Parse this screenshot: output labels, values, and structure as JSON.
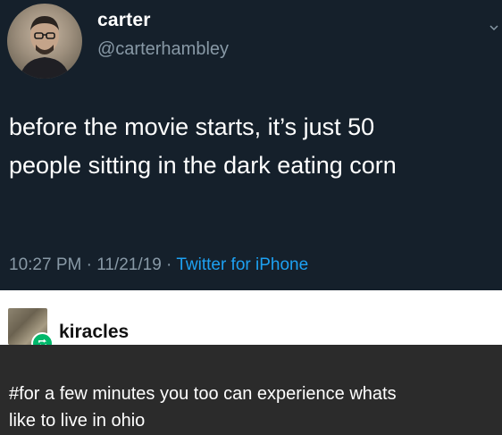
{
  "tweet": {
    "display_name": "carter",
    "handle": "@carterhambley",
    "text_lines": [
      "before the movie starts, it’s just 50",
      "people sitting in the dark eating corn"
    ],
    "time": "10:27 PM",
    "separator": " · ",
    "date": "11/21/19",
    "source": "Twitter for iPhone"
  },
  "reblog": {
    "username": "kiracles",
    "badge_icon": "reblog-icon",
    "badge_color": "#00b86b"
  },
  "tags": {
    "lines": [
      "#for a few minutes you too can experience whats",
      "like to live in ohio"
    ]
  },
  "colors": {
    "tweet_bg": "#15202b",
    "meta_gray": "#8899a6",
    "link_blue": "#1da1f2",
    "tags_bg": "#2b2b2b"
  }
}
